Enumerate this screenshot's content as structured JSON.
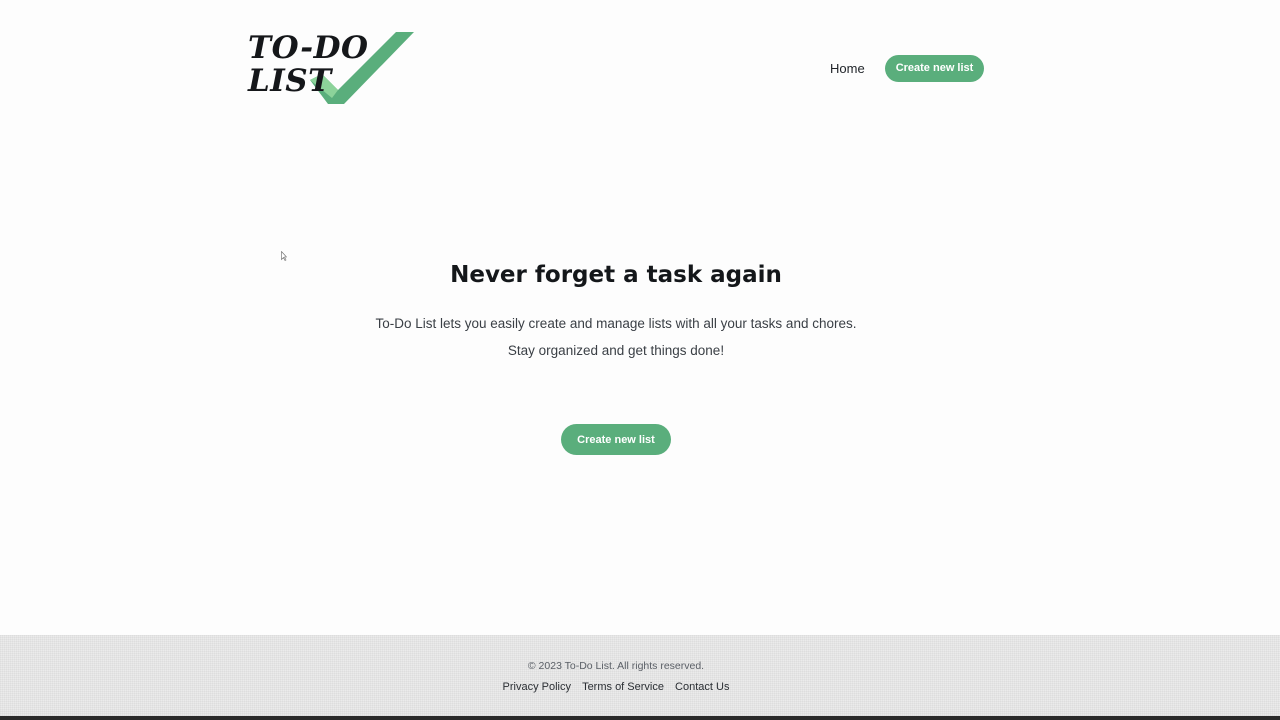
{
  "logo": {
    "line1": "TO-DO",
    "line2": "LIST",
    "check_color": "#5aae7c"
  },
  "nav": {
    "home_label": "Home",
    "create_label": "Create new list"
  },
  "hero": {
    "title": "Never forget a task again",
    "line1": "To-Do List lets you easily create and manage lists with all your tasks and chores.",
    "line2": "Stay organized and get things done!",
    "button_label": "Create new list"
  },
  "footer": {
    "copyright": "© 2023 To-Do List. All rights reserved.",
    "links": {
      "privacy": "Privacy Policy",
      "terms": "Terms of Service",
      "contact": "Contact Us"
    }
  },
  "colors": {
    "accent": "#5aae7c",
    "footer_bg": "#ebebeb"
  },
  "icons": {
    "cursor": "mouse-pointer-icon",
    "logo_check": "checkmark-icon"
  }
}
